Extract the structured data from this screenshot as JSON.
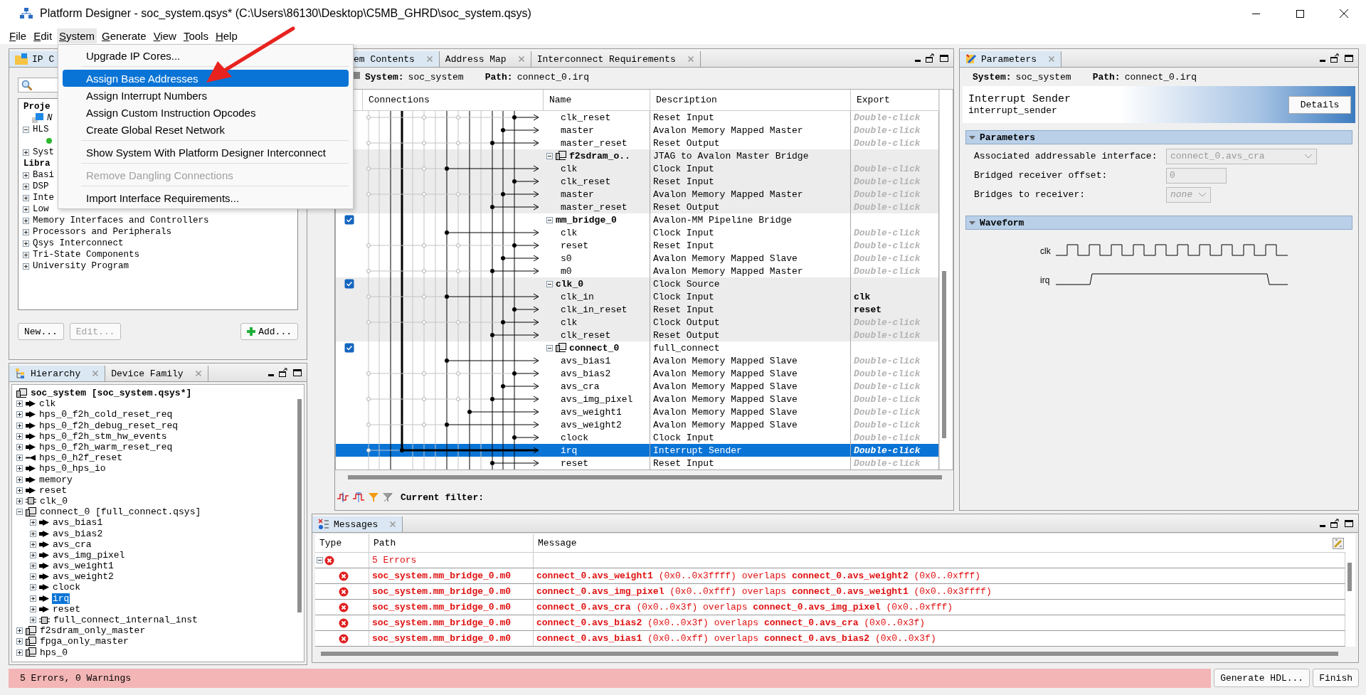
{
  "window": {
    "title": "Platform Designer - soc_system.qsys* (C:\\Users\\86130\\Desktop\\C5MB_GHRD\\soc_system.qsys)"
  },
  "menu": [
    {
      "label": "File",
      "selected": false
    },
    {
      "label": "Edit",
      "selected": false
    },
    {
      "label": "System",
      "selected": true
    },
    {
      "label": "Generate",
      "selected": false
    },
    {
      "label": "View",
      "selected": false
    },
    {
      "label": "Tools",
      "selected": false
    },
    {
      "label": "Help",
      "selected": false
    }
  ],
  "system_menu": [
    {
      "kind": "item",
      "label": "Upgrade IP Cores...",
      "selected": false,
      "disabled": false
    },
    {
      "kind": "separator"
    },
    {
      "kind": "item",
      "label": "Assign Base Addresses",
      "selected": true,
      "disabled": false
    },
    {
      "kind": "item",
      "label": "Assign Interrupt Numbers",
      "selected": false,
      "disabled": false
    },
    {
      "kind": "item",
      "label": "Assign Custom Instruction Opcodes",
      "selected": false,
      "disabled": false
    },
    {
      "kind": "item",
      "label": "Create Global Reset Network",
      "selected": false,
      "disabled": false
    },
    {
      "kind": "separator"
    },
    {
      "kind": "item",
      "label": "Show System With Platform Designer Interconnect",
      "selected": false,
      "disabled": false
    },
    {
      "kind": "separator"
    },
    {
      "kind": "item",
      "label": "Remove Dangling Connections",
      "selected": false,
      "disabled": true
    },
    {
      "kind": "separator"
    },
    {
      "kind": "item",
      "label": "Import Interface Requirements...",
      "selected": false,
      "disabled": false
    }
  ],
  "ip_catalog": {
    "tabs": [
      {
        "label": "IP C",
        "selected": true
      }
    ],
    "tree": [
      {
        "kind": "heading",
        "label": "Proje",
        "children": [
          {
            "kind": "component",
            "label": "N"
          },
          {
            "kind": "folder",
            "label": "HLS",
            "expanded": true,
            "children": [
              {
                "kind": "dot"
              }
            ]
          },
          {
            "kind": "folder",
            "label": "Syst",
            "expanded": false
          }
        ]
      },
      {
        "kind": "heading",
        "label": "Libra",
        "children": [
          {
            "kind": "folder",
            "label": "Basi",
            "expanded": false
          },
          {
            "kind": "folder",
            "label": "DSP",
            "expanded": false
          },
          {
            "kind": "folder",
            "label": "Inte",
            "expanded": false
          },
          {
            "kind": "folder",
            "label": "Low",
            "expanded": false
          },
          {
            "kind": "folder",
            "label": "Memory Interfaces and Controllers",
            "expanded": false
          },
          {
            "kind": "folder",
            "label": "Processors and Peripherals",
            "expanded": false
          },
          {
            "kind": "folder",
            "label": "Qsys Interconnect",
            "expanded": false
          },
          {
            "kind": "folder",
            "label": "Tri-State Components",
            "expanded": false
          },
          {
            "kind": "folder",
            "label": "University Program",
            "expanded": false
          }
        ]
      }
    ],
    "buttons": [
      {
        "label": "New...",
        "kind": "plain",
        "disabled": false
      },
      {
        "label": "Edit...",
        "kind": "plain",
        "disabled": true
      },
      {
        "label": "Add...",
        "kind": "add",
        "disabled": false
      }
    ]
  },
  "hierarchy": {
    "tabs": [
      {
        "label": "Hierarchy",
        "selected": true,
        "closable": true
      },
      {
        "label": "Device Family",
        "selected": false,
        "closable": true
      }
    ],
    "tree": [
      {
        "label": "soc_system [soc_system.qsys*]",
        "kind": "root",
        "selected": false,
        "children": [
          {
            "label": "clk",
            "kind": "port-out",
            "expanded": false,
            "selected": false
          },
          {
            "label": "hps_0_f2h_cold_reset_req",
            "kind": "port-out",
            "expanded": false,
            "selected": false
          },
          {
            "label": "hps_0_f2h_debug_reset_req",
            "kind": "port-out",
            "expanded": false,
            "selected": false
          },
          {
            "label": "hps_0_f2h_stm_hw_events",
            "kind": "port-out",
            "expanded": false,
            "selected": false
          },
          {
            "label": "hps_0_f2h_warm_reset_req",
            "kind": "port-out",
            "expanded": false,
            "selected": false
          },
          {
            "label": "hps_0_h2f_reset",
            "kind": "port-in",
            "expanded": false,
            "selected": false
          },
          {
            "label": "hps_0_hps_io",
            "kind": "port-out",
            "expanded": false,
            "selected": false
          },
          {
            "label": "memory",
            "kind": "port-out",
            "expanded": false,
            "selected": false
          },
          {
            "label": "reset",
            "kind": "port-out",
            "expanded": false,
            "selected": false
          },
          {
            "label": "clk_0",
            "kind": "module",
            "expanded": false,
            "selected": false
          },
          {
            "label": "connect_0 [full_connect.qsys]",
            "kind": "system",
            "expanded": true,
            "selected": false,
            "children": [
              {
                "label": "avs_bias1",
                "kind": "port-out",
                "expanded": false,
                "selected": false
              },
              {
                "label": "avs_bias2",
                "kind": "port-out",
                "expanded": false,
                "selected": false
              },
              {
                "label": "avs_cra",
                "kind": "port-out",
                "expanded": false,
                "selected": false
              },
              {
                "label": "avs_img_pixel",
                "kind": "port-out",
                "expanded": false,
                "selected": false
              },
              {
                "label": "avs_weight1",
                "kind": "port-out",
                "expanded": false,
                "selected": false
              },
              {
                "label": "avs_weight2",
                "kind": "port-out",
                "expanded": false,
                "selected": false
              },
              {
                "label": "clock",
                "kind": "port-out",
                "expanded": false,
                "selected": false
              },
              {
                "label": "irq",
                "kind": "port-out",
                "expanded": false,
                "selected": true
              },
              {
                "label": "reset",
                "kind": "port-out",
                "expanded": false,
                "selected": false
              },
              {
                "label": "full_connect_internal_inst",
                "kind": "module",
                "expanded": false,
                "selected": false
              }
            ]
          },
          {
            "label": "f2sdram_only_master",
            "kind": "system",
            "expanded": false,
            "selected": false
          },
          {
            "label": "fpga_only_master",
            "kind": "system",
            "expanded": false,
            "selected": false
          },
          {
            "label": "hps_0",
            "kind": "system",
            "expanded": false,
            "selected": false
          }
        ]
      }
    ]
  },
  "system_contents": {
    "tabs": [
      {
        "label": "em Contents",
        "selected": true,
        "closable": true
      },
      {
        "label": "Address Map",
        "selected": false,
        "closable": true
      },
      {
        "label": "Interconnect Requirements",
        "selected": false,
        "closable": true
      }
    ],
    "system_label": "System:",
    "system": "soc_system",
    "path_label": "Path:",
    "path": "connect_0.irq",
    "columns": [
      "Connections",
      "Name",
      "Description",
      "Export"
    ],
    "groups": [
      {
        "ports": [
          {
            "name": "clk_reset",
            "description": "Reset Input",
            "export_hint": "Double-click",
            "selected": false
          },
          {
            "name": "master",
            "description": "Avalon Memory Mapped Master",
            "export_hint": "Double-click",
            "selected": false
          },
          {
            "name": "master_reset",
            "description": "Reset Output",
            "export_hint": "Double-click",
            "selected": false
          }
        ]
      },
      {
        "name": "f2sdram_o..",
        "kind": "subsystem",
        "expanded": true,
        "description": "JTAG to Avalon Master Bridge",
        "selected": false,
        "ports": [
          {
            "name": "clk",
            "description": "Clock Input",
            "export_hint": "Double-click",
            "selected": false
          },
          {
            "name": "clk_reset",
            "description": "Reset Input",
            "export_hint": "Double-click",
            "selected": false
          },
          {
            "name": "master",
            "description": "Avalon Memory Mapped Master",
            "export_hint": "Double-click",
            "selected": false
          },
          {
            "name": "master_reset",
            "description": "Reset Output",
            "export_hint": "Double-click",
            "selected": false
          }
        ]
      },
      {
        "name": "mm_bridge_0",
        "kind": "component",
        "checked": true,
        "expanded": true,
        "description": "Avalon-MM Pipeline Bridge",
        "selected": false,
        "ports": [
          {
            "name": "clk",
            "description": "Clock Input",
            "export_hint": "Double-click",
            "selected": false
          },
          {
            "name": "reset",
            "description": "Reset Input",
            "export_hint": "Double-click",
            "selected": false
          },
          {
            "name": "s0",
            "description": "Avalon Memory Mapped Slave",
            "export_hint": "Double-click",
            "selected": false
          },
          {
            "name": "m0",
            "description": "Avalon Memory Mapped Master",
            "export_hint": "Double-click",
            "selected": false
          }
        ]
      },
      {
        "name": "clk_0",
        "kind": "component",
        "checked": true,
        "expanded": true,
        "description": "Clock Source",
        "selected": false,
        "ports": [
          {
            "name": "clk_in",
            "description": "Clock Input",
            "export": "clk",
            "selected": false
          },
          {
            "name": "clk_in_reset",
            "description": "Reset Input",
            "export": "reset",
            "selected": false
          },
          {
            "name": "clk",
            "description": "Clock Output",
            "export_hint": "Double-click",
            "selected": false
          },
          {
            "name": "clk_reset",
            "description": "Reset Output",
            "export_hint": "Double-click",
            "selected": false
          }
        ]
      },
      {
        "name": "connect_0",
        "kind": "subsystem",
        "checked": true,
        "expanded": true,
        "description": "full_connect",
        "selected": false,
        "ports": [
          {
            "name": "avs_bias1",
            "description": "Avalon Memory Mapped Slave",
            "export_hint": "Double-click",
            "selected": false
          },
          {
            "name": "avs_bias2",
            "description": "Avalon Memory Mapped Slave",
            "export_hint": "Double-click",
            "selected": false
          },
          {
            "name": "avs_cra",
            "description": "Avalon Memory Mapped Slave",
            "export_hint": "Double-click",
            "selected": false
          },
          {
            "name": "avs_img_pixel",
            "description": "Avalon Memory Mapped Slave",
            "export_hint": "Double-click",
            "selected": false
          },
          {
            "name": "avs_weight1",
            "description": "Avalon Memory Mapped Slave",
            "export_hint": "Double-click",
            "selected": false
          },
          {
            "name": "avs_weight2",
            "description": "Avalon Memory Mapped Slave",
            "export_hint": "Double-click",
            "selected": false
          },
          {
            "name": "clock",
            "description": "Clock Input",
            "export_hint": "Double-click",
            "selected": false
          },
          {
            "name": "irq",
            "description": "Interrupt Sender",
            "export_hint": "Double-click",
            "selected": true
          },
          {
            "name": "reset",
            "description": "Reset Input",
            "export_hint": "Double-click",
            "selected": false
          }
        ]
      }
    ],
    "filter_label": "Current filter:"
  },
  "parameters": {
    "tabs": [
      {
        "label": "Parameters",
        "selected": true,
        "closable": true
      }
    ],
    "system_label": "System:",
    "system": "soc_system",
    "path_label": "Path:",
    "path": "connect_0.irq",
    "title": "Interrupt Sender",
    "subtitle": "interrupt_sender",
    "details_button": "Details",
    "sections": [
      {
        "title": "Parameters",
        "expanded": true,
        "fields": [
          {
            "label": "Associated addressable interface:",
            "kind": "dropdown",
            "value": "connect_0.avs_cra",
            "disabled": true
          },
          {
            "label": "Bridged receiver offset:",
            "kind": "text",
            "value": "0",
            "disabled": true
          },
          {
            "label": "Bridges to receiver:",
            "kind": "dropdown",
            "value": "none",
            "disabled": true,
            "italic": true
          }
        ]
      },
      {
        "title": "Waveform",
        "expanded": true,
        "signals": [
          {
            "name": "clk",
            "kind": "clock"
          },
          {
            "name": "irq",
            "kind": "pulse"
          }
        ]
      }
    ]
  },
  "messages": {
    "tabs": [
      {
        "label": "Messages",
        "selected": true,
        "closable": true
      }
    ],
    "columns": [
      "Type",
      "Path",
      "Message"
    ],
    "group": {
      "label": "5 Errors",
      "expanded": true
    },
    "rows": [
      {
        "path": "soc_system.mm_bridge_0.m0",
        "message": "**connect_0.avs_weight1** (0x0..0x3ffff) overlaps **connect_0.avs_weight2** (0x0..0xfff)"
      },
      {
        "path": "soc_system.mm_bridge_0.m0",
        "message": "**connect_0.avs_img_pixel** (0x0..0xfff) overlaps **connect_0.avs_weight1** (0x0..0x3ffff)"
      },
      {
        "path": "soc_system.mm_bridge_0.m0",
        "message": "**connect_0.avs_cra** (0x0..0x3f) overlaps **connect_0.avs_img_pixel** (0x0..0xfff)"
      },
      {
        "path": "soc_system.mm_bridge_0.m0",
        "message": "**connect_0.avs_bias2** (0x0..0x3f) overlaps **connect_0.avs_cra** (0x0..0x3f)"
      },
      {
        "path": "soc_system.mm_bridge_0.m0",
        "message": "**connect_0.avs_bias1** (0x0..0xff) overlaps **connect_0.avs_bias2** (0x0..0x3f)"
      }
    ]
  },
  "status_bar": {
    "text": "5 Errors, 0 Warnings",
    "buttons": [
      "Generate HDL...",
      "Finish"
    ]
  }
}
